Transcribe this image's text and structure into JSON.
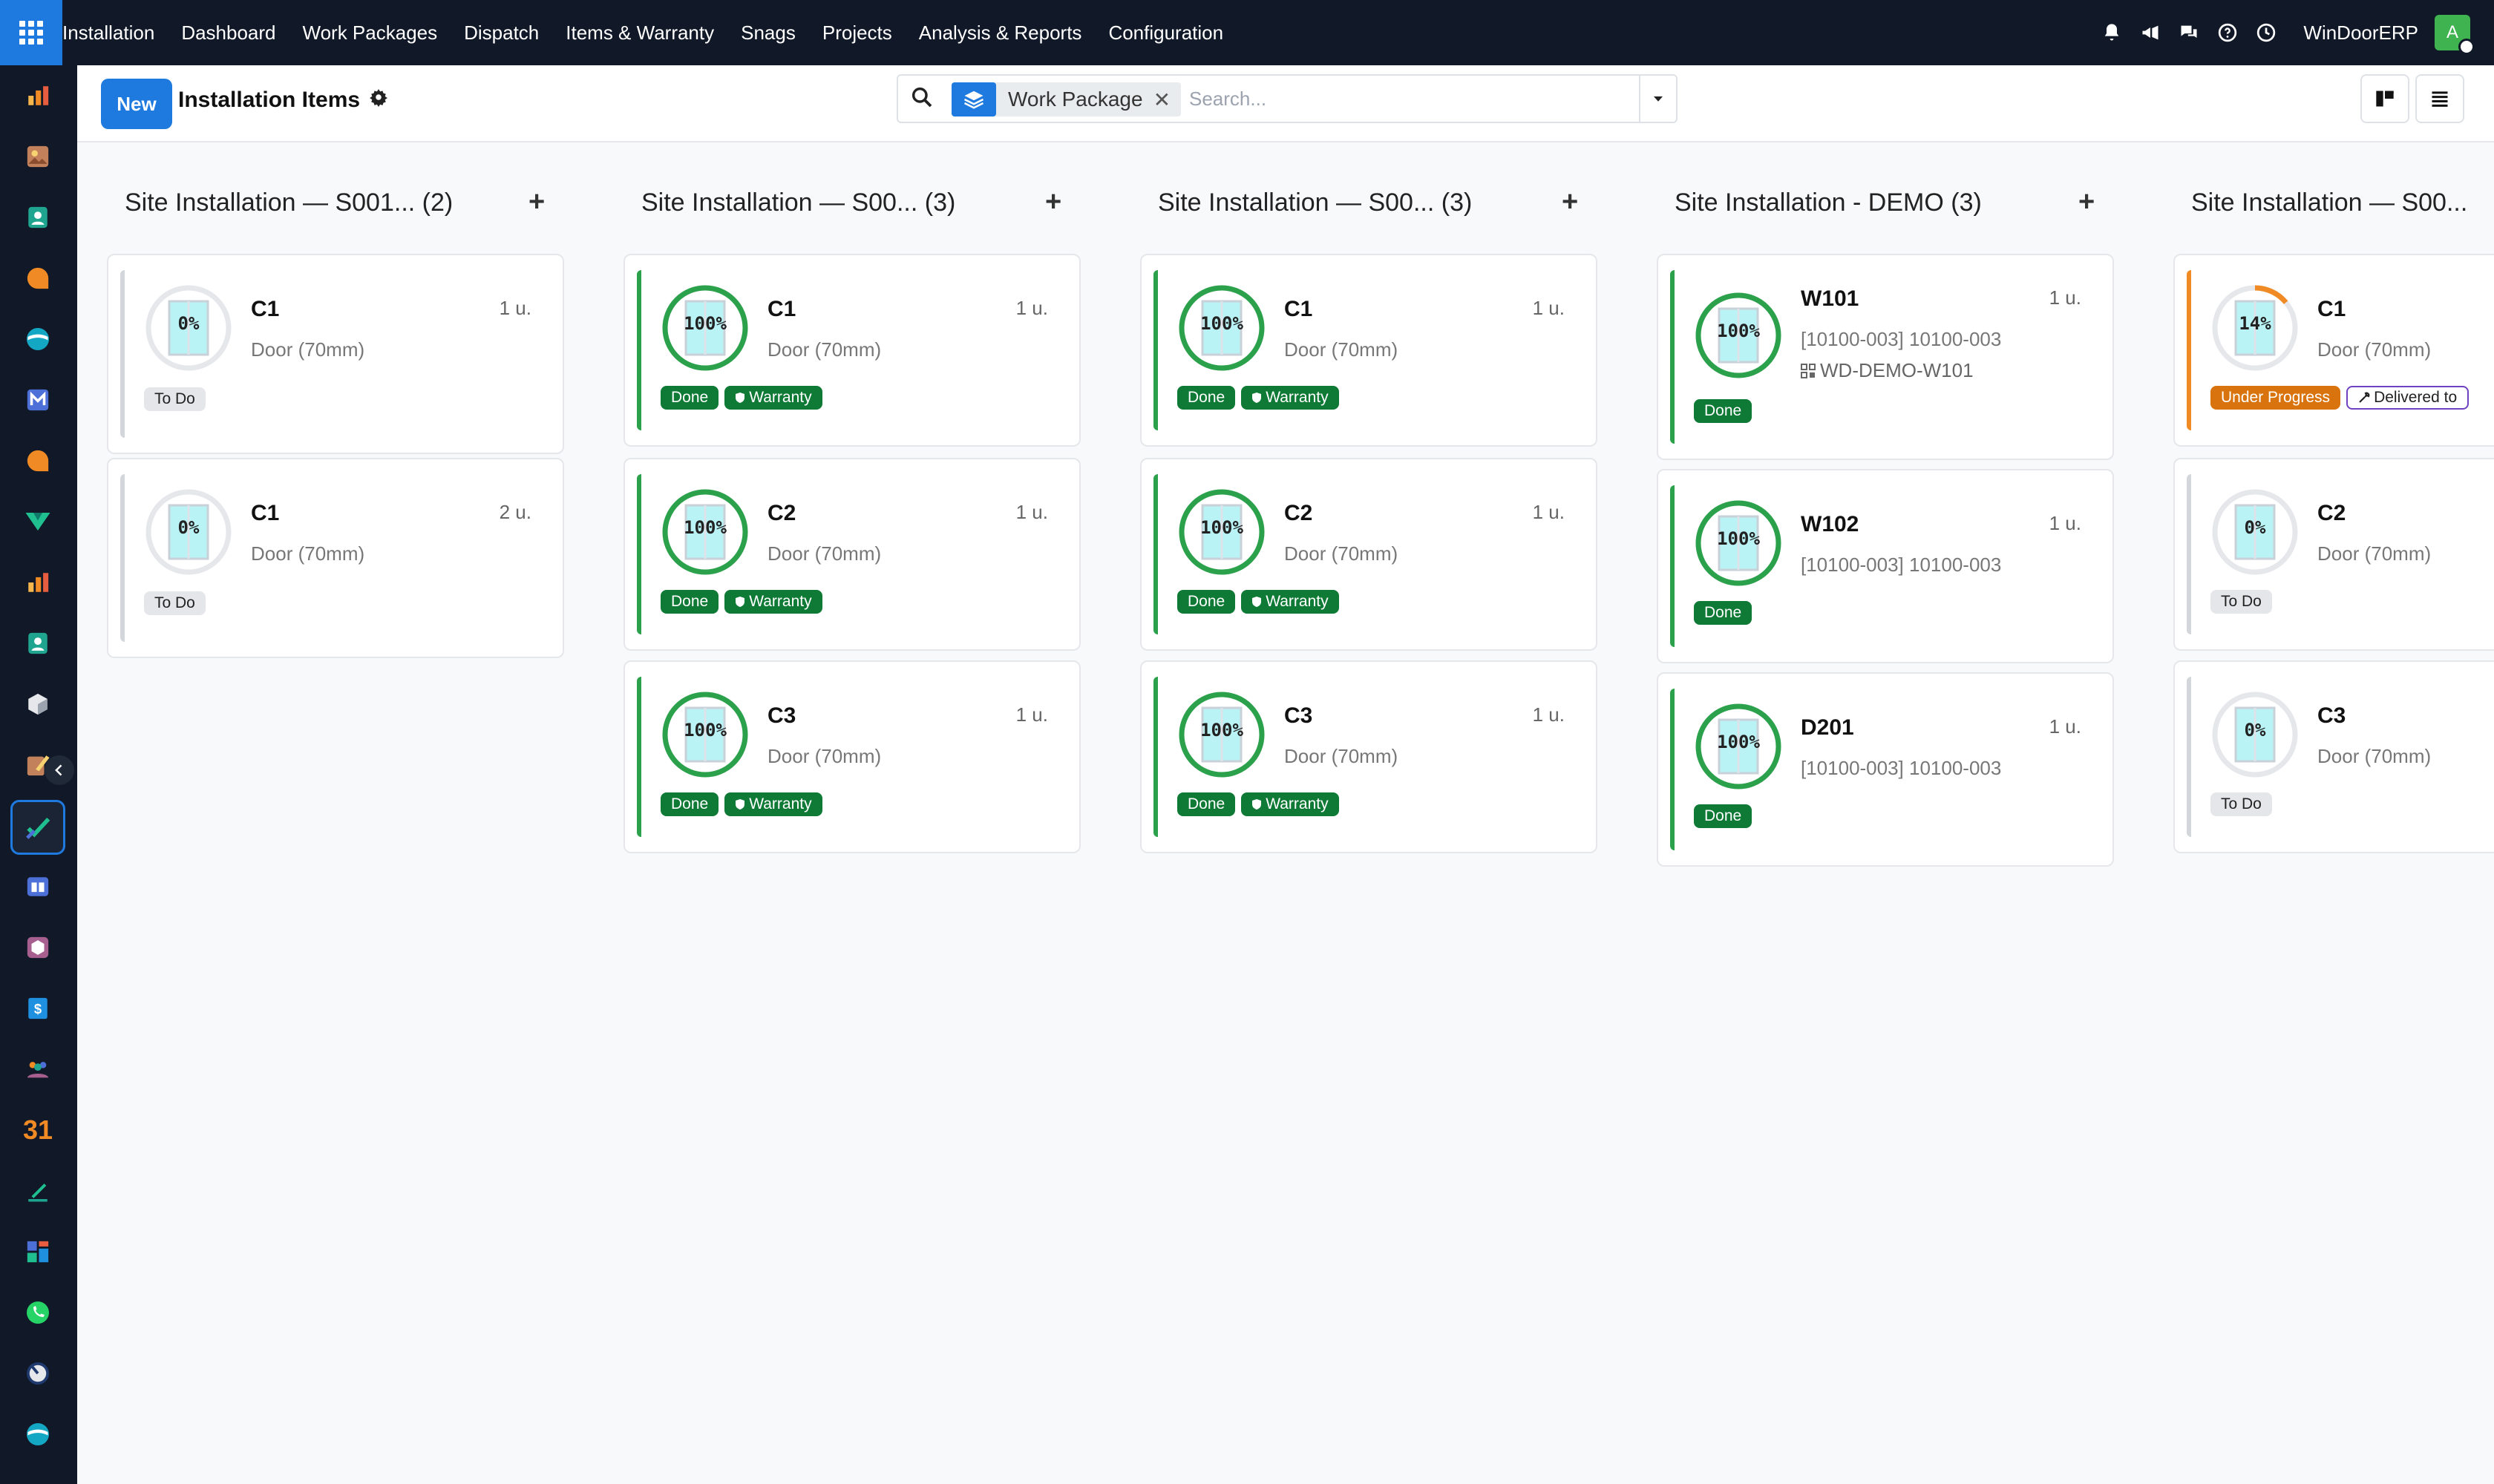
{
  "navbar": {
    "menu": [
      "Installation",
      "Dashboard",
      "Work Packages",
      "Dispatch",
      "Items & Warranty",
      "Snags",
      "Projects",
      "Analysis & Reports",
      "Configuration"
    ],
    "company": "WinDoorERP",
    "avatar_letter": "A"
  },
  "sidebar": {
    "apps": [
      "sales-app-icon",
      "photo-app-icon",
      "contacts-app-icon",
      "discuss-app-icon",
      "sync-app-icon",
      "mail-app-icon",
      "chat-app-icon",
      "helpdesk-app-icon",
      "reports-app-icon",
      "employees-app-icon",
      "inventory-app-icon",
      "notes-app-icon",
      "installation-app-icon",
      "knowledge-app-icon",
      "product-app-icon",
      "invoice-app-icon",
      "team-app-icon",
      "calendar-app-icon",
      "sign-app-icon",
      "dashboard-app-icon",
      "whatsapp-app-icon",
      "timer-app-icon",
      "wave-app-icon"
    ],
    "calendar_label": "31"
  },
  "control_panel": {
    "new_label": "New",
    "title": "Installation Items",
    "facet_label": "Work Package",
    "facet_remove": "✕",
    "search_placeholder": "Search..."
  },
  "colors": {
    "accent": "#1f7ae0",
    "done": "#2ba14b",
    "progress": "#f08a24",
    "todo": "#d3d6da"
  },
  "columns": [
    {
      "title": "Site Installation — S001...  (2)",
      "add": "+",
      "cards": [
        {
          "name": "C1",
          "qty": "1 u.",
          "sub": "Door (70mm)",
          "pct": "0%",
          "progress": 0,
          "status": "todo",
          "badges": [
            {
              "label": "To Do",
              "kind": "todo"
            }
          ]
        },
        {
          "name": "C1",
          "qty": "2 u.",
          "sub": "Door (70mm)",
          "pct": "0%",
          "progress": 0,
          "status": "todo",
          "badges": [
            {
              "label": "To Do",
              "kind": "todo"
            }
          ]
        }
      ]
    },
    {
      "title": "Site Installation — S00...   (3)",
      "add": "+",
      "cards": [
        {
          "name": "C1",
          "qty": "1 u.",
          "sub": "Door (70mm)",
          "pct": "100%",
          "progress": 100,
          "status": "done",
          "badges": [
            {
              "label": "Done",
              "kind": "done"
            },
            {
              "label": "Warranty",
              "kind": "warr"
            }
          ]
        },
        {
          "name": "C2",
          "qty": "1 u.",
          "sub": "Door (70mm)",
          "pct": "100%",
          "progress": 100,
          "status": "done",
          "badges": [
            {
              "label": "Done",
              "kind": "done"
            },
            {
              "label": "Warranty",
              "kind": "warr"
            }
          ]
        },
        {
          "name": "C3",
          "qty": "1 u.",
          "sub": "Door (70mm)",
          "pct": "100%",
          "progress": 100,
          "status": "done",
          "badges": [
            {
              "label": "Done",
              "kind": "done"
            },
            {
              "label": "Warranty",
              "kind": "warr"
            }
          ]
        }
      ]
    },
    {
      "title": "Site Installation — S00...   (3)",
      "add": "+",
      "cards": [
        {
          "name": "C1",
          "qty": "1 u.",
          "sub": "Door (70mm)",
          "pct": "100%",
          "progress": 100,
          "status": "done",
          "badges": [
            {
              "label": "Done",
              "kind": "done"
            },
            {
              "label": "Warranty",
              "kind": "warr"
            }
          ]
        },
        {
          "name": "C2",
          "qty": "1 u.",
          "sub": "Door (70mm)",
          "pct": "100%",
          "progress": 100,
          "status": "done",
          "badges": [
            {
              "label": "Done",
              "kind": "done"
            },
            {
              "label": "Warranty",
              "kind": "warr"
            }
          ]
        },
        {
          "name": "C3",
          "qty": "1 u.",
          "sub": "Door (70mm)",
          "pct": "100%",
          "progress": 100,
          "status": "done",
          "badges": [
            {
              "label": "Done",
              "kind": "done"
            },
            {
              "label": "Warranty",
              "kind": "warr"
            }
          ]
        }
      ]
    },
    {
      "title": "Site Installation - DEMO (3)",
      "add": "+",
      "cards": [
        {
          "name": "W101",
          "qty": "1 u.",
          "sub": "[10100-003] 10100-003",
          "sub2": "WD-DEMO-W101",
          "pct": "100%",
          "progress": 100,
          "status": "done",
          "badges": [
            {
              "label": "Done",
              "kind": "done"
            }
          ]
        },
        {
          "name": "W102",
          "qty": "1 u.",
          "sub": "[10100-003] 10100-003",
          "pct": "100%",
          "progress": 100,
          "status": "done",
          "badges": [
            {
              "label": "Done",
              "kind": "done"
            }
          ]
        },
        {
          "name": "D201",
          "qty": "1 u.",
          "sub": "[10100-003] 10100-003",
          "pct": "100%",
          "progress": 100,
          "status": "done",
          "badges": [
            {
              "label": "Done",
              "kind": "done"
            }
          ]
        }
      ]
    },
    {
      "title": "Site Installation — S00...",
      "add": "",
      "cards": [
        {
          "name": "C1",
          "qty": "",
          "sub": "Door (70mm)",
          "pct": "14%",
          "progress": 14,
          "status": "progress",
          "badges": [
            {
              "label": "Under Progress",
              "kind": "prog"
            },
            {
              "label": "Delivered to",
              "kind": "deliv"
            }
          ]
        },
        {
          "name": "C2",
          "qty": "",
          "sub": "Door (70mm)",
          "pct": "0%",
          "progress": 0,
          "status": "todo",
          "badges": [
            {
              "label": "To Do",
              "kind": "todo"
            }
          ]
        },
        {
          "name": "C3",
          "qty": "",
          "sub": "Door (70mm)",
          "pct": "0%",
          "progress": 0,
          "status": "todo",
          "badges": [
            {
              "label": "To Do",
              "kind": "todo"
            }
          ]
        }
      ]
    }
  ]
}
